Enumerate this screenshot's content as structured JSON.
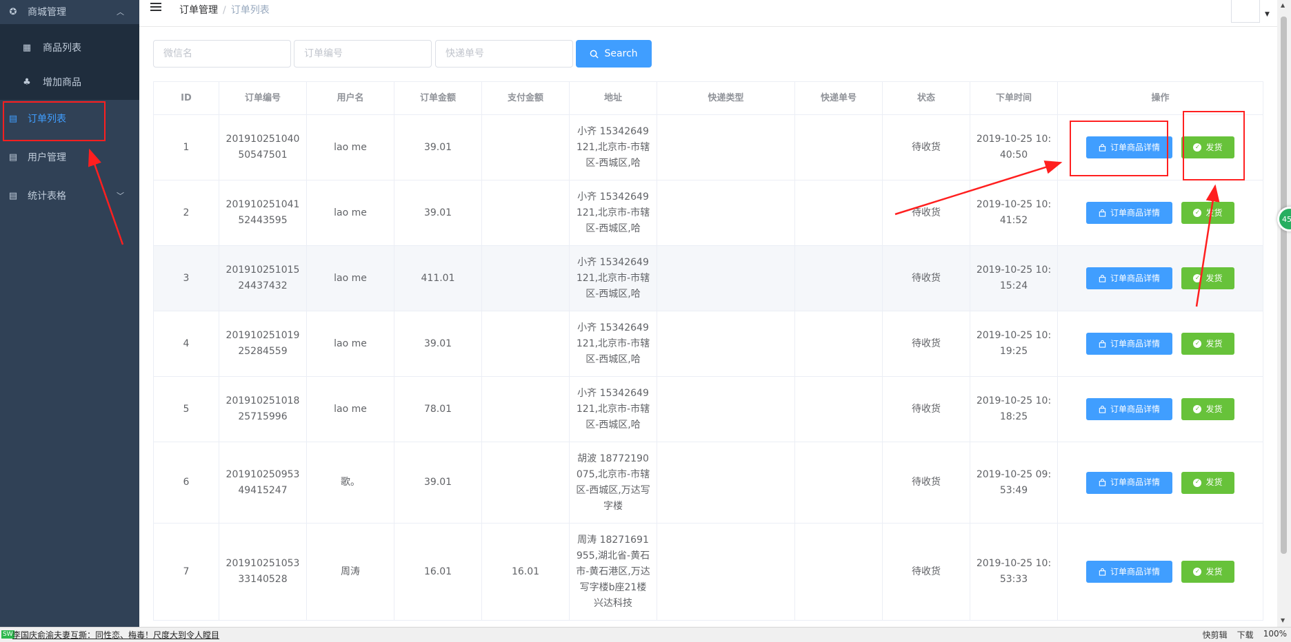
{
  "sidebar": {
    "items": [
      {
        "label": "商城管理",
        "icon": "circle-gear-icon"
      },
      {
        "label": "商品列表",
        "icon": "grid-icon"
      },
      {
        "label": "增加商品",
        "icon": "sitemap-icon"
      },
      {
        "label": "订单列表",
        "icon": "document-icon"
      },
      {
        "label": "用户管理",
        "icon": "document-edit-icon"
      },
      {
        "label": "统计表格",
        "icon": "document-edit-icon"
      }
    ]
  },
  "header": {
    "breadcrumb": [
      "订单管理",
      "订单列表"
    ]
  },
  "filters": {
    "wechat_placeholder": "微信名",
    "order_no_placeholder": "订单编号",
    "express_no_placeholder": "快递单号",
    "search_label": "Search"
  },
  "table": {
    "columns": [
      "ID",
      "订单编号",
      "用户名",
      "订单金额",
      "支付金额",
      "地址",
      "快递类型",
      "快递单号",
      "状态",
      "下单时间",
      "操作"
    ],
    "rows": [
      {
        "id": "1",
        "order_no": "20191025104050547501",
        "user": "lao me",
        "amount": "39.01",
        "paid": "",
        "address": "小齐 15342649121,北京市-市辖区-西城区,哈",
        "express_type": "",
        "express_no": "",
        "status": "待收货",
        "time": "2019-10-25 10:40:50"
      },
      {
        "id": "2",
        "order_no": "20191025104152443595",
        "user": "lao me",
        "amount": "39.01",
        "paid": "",
        "address": "小齐 15342649121,北京市-市辖区-西城区,哈",
        "express_type": "",
        "express_no": "",
        "status": "待收货",
        "time": "2019-10-25 10:41:52"
      },
      {
        "id": "3",
        "order_no": "20191025101524437432",
        "user": "lao me",
        "amount": "411.01",
        "paid": "",
        "address": "小齐 15342649121,北京市-市辖区-西城区,哈",
        "express_type": "",
        "express_no": "",
        "status": "待收货",
        "time": "2019-10-25 10:15:24"
      },
      {
        "id": "4",
        "order_no": "20191025101925284559",
        "user": "lao me",
        "amount": "39.01",
        "paid": "",
        "address": "小齐 15342649121,北京市-市辖区-西城区,哈",
        "express_type": "",
        "express_no": "",
        "status": "待收货",
        "time": "2019-10-25 10:19:25"
      },
      {
        "id": "5",
        "order_no": "20191025101825715996",
        "user": "lao me",
        "amount": "78.01",
        "paid": "",
        "address": "小齐 15342649121,北京市-市辖区-西城区,哈",
        "express_type": "",
        "express_no": "",
        "status": "待收货",
        "time": "2019-10-25 10:18:25"
      },
      {
        "id": "6",
        "order_no": "20191025095349415247",
        "user": "歌。",
        "amount": "39.01",
        "paid": "",
        "address": "胡波 18772190075,北京市-市辖区-西城区,万达写字楼",
        "express_type": "",
        "express_no": "",
        "status": "待收货",
        "time": "2019-10-25 09:53:49"
      },
      {
        "id": "7",
        "order_no": "20191025105333140528",
        "user": "周涛",
        "amount": "16.01",
        "paid": "16.01",
        "address": "周涛 18271691955,湖北省-黄石市-黄石港区,万达写字楼b座21楼兴达科技",
        "express_type": "",
        "express_no": "",
        "status": "待收货",
        "time": "2019-10-25 10:53:33"
      }
    ],
    "detail_label": "订单商品详情",
    "ship_label": "发货"
  },
  "badge": "45",
  "statusbar": {
    "news": "李国庆俞渝夫妻互撕：同性恋、梅毒！尺度大到令人瞠目",
    "items": [
      "快剪辑",
      "下载",
      "100%"
    ]
  }
}
